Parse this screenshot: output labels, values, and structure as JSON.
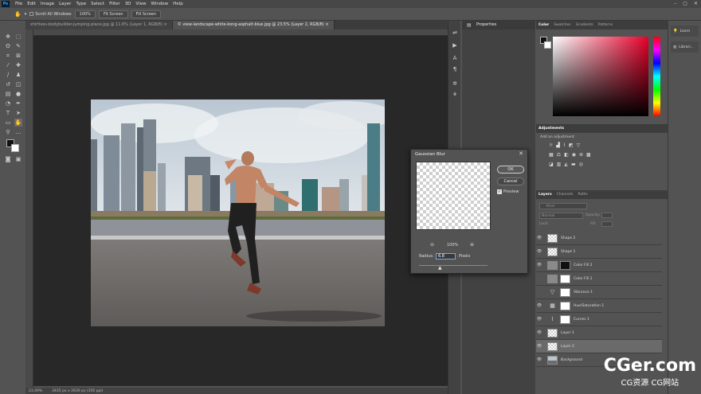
{
  "app": {
    "logo": "Ps"
  },
  "menu": [
    "File",
    "Edit",
    "Image",
    "Layer",
    "Type",
    "Select",
    "Filter",
    "3D",
    "View",
    "Window",
    "Help"
  ],
  "options_bar": {
    "scroll_all_label": "Scroll All Windows",
    "zoom_value": "100%",
    "fit_screen": "Fit Screen",
    "fill_screen": "Fill Screen"
  },
  "doc_tabs": [
    {
      "label": "shirtless-bodybuilder-jumping-place.jpg @ 11.6% (Layer 1, RGB/8) ×",
      "active": false
    },
    {
      "label": "© view-landscape-white-kong-asphalt-blue.jpg @ 23.5% (Layer 2, RGB/8) ×",
      "active": true
    }
  ],
  "status": {
    "zoom": "23.49%",
    "doc_info": "3435 px x 2630 px (350 ppi)"
  },
  "properties_panel": {
    "title": "Properties"
  },
  "color_panel": {
    "tabs": [
      "Color",
      "Swatches",
      "Gradients",
      "Patterns"
    ]
  },
  "adjustments_panel": {
    "tab": "Adjustments",
    "caption": "Add an adjustment"
  },
  "layers_panel": {
    "tabs": [
      "Layers",
      "Channels",
      "Paths"
    ],
    "kind_label": "Kind",
    "mode": "Normal",
    "opacity_label": "Opacity:",
    "lock_label": "Lock:",
    "fill_label": "Fill:",
    "layers": [
      {
        "name": "Shape 2",
        "thumb": "checker",
        "mask": false
      },
      {
        "name": "Shape 1",
        "thumb": "checker",
        "mask": false
      },
      {
        "name": "Color Fill 2",
        "thumb": "solid",
        "mask": true
      },
      {
        "name": "Color Fill 1",
        "thumb": "solid",
        "mask": true
      },
      {
        "name": "Vibrance 1",
        "thumb": "icon",
        "mask": true
      },
      {
        "name": "Hue/Saturation 1",
        "thumb": "icon",
        "mask": true
      },
      {
        "name": "Curves 1",
        "thumb": "icon",
        "mask": true
      },
      {
        "name": "Layer 1",
        "thumb": "checker",
        "mask": false
      },
      {
        "name": "Layer 2",
        "thumb": "checker",
        "mask": false,
        "selected": true
      },
      {
        "name": "Background",
        "thumb": "photo",
        "mask": false
      }
    ]
  },
  "learn_panel": {
    "items": [
      "Learn",
      "Librari..."
    ]
  },
  "dialog": {
    "title": "Gaussian Blur",
    "ok": "OK",
    "cancel": "Cancel",
    "preview_label": "Preview",
    "zoom": "100%",
    "radius_label": "Radius:",
    "radius_value": "6.8",
    "unit": "Pixels"
  },
  "watermark": {
    "main": "CGer.com",
    "sub": "CG资源 CG网站"
  }
}
